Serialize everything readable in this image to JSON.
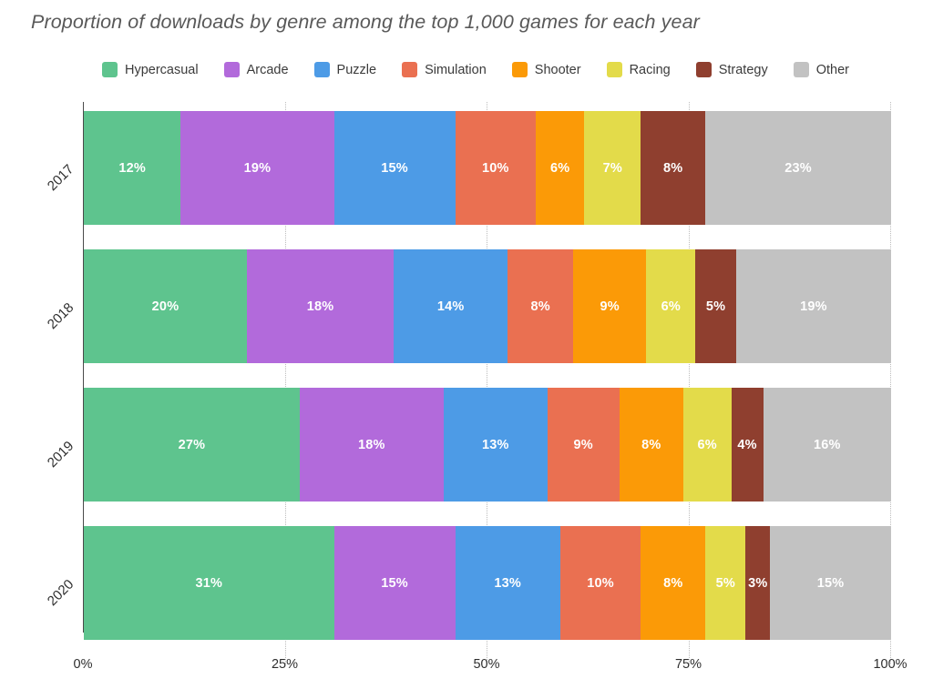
{
  "chart_data": {
    "type": "bar",
    "orientation": "horizontal",
    "stacked": true,
    "normalized": true,
    "title": "Proportion of downloads by genre among the top 1,000 games for each year",
    "xlabel": "",
    "ylabel": "",
    "categories": [
      "2017",
      "2018",
      "2019",
      "2020"
    ],
    "xlim": [
      0,
      100
    ],
    "xticks": [
      0,
      25,
      50,
      75,
      100
    ],
    "xtick_labels": [
      "0%",
      "25%",
      "50%",
      "75%",
      "100%"
    ],
    "grid": "vertical-dotted",
    "legend_position": "top",
    "series": [
      {
        "name": "Hypercasual",
        "color": "#5EC48E",
        "values": [
          12,
          20,
          27,
          31
        ],
        "labels": [
          "12%",
          "20%",
          "27%",
          "31%"
        ]
      },
      {
        "name": "Arcade",
        "color": "#B26ADB",
        "values": [
          19,
          18,
          18,
          15
        ],
        "labels": [
          "19%",
          "18%",
          "18%",
          "15%"
        ]
      },
      {
        "name": "Puzzle",
        "color": "#4D9BE6",
        "values": [
          15,
          14,
          13,
          13
        ],
        "labels": [
          "15%",
          "14%",
          "13%",
          "13%"
        ]
      },
      {
        "name": "Simulation",
        "color": "#EA7051",
        "values": [
          10,
          8,
          9,
          10
        ],
        "labels": [
          "10%",
          "8%",
          "9%",
          "10%"
        ]
      },
      {
        "name": "Shooter",
        "color": "#FB9A07",
        "values": [
          6,
          9,
          8,
          8
        ],
        "labels": [
          "6%",
          "9%",
          "8%",
          "8%"
        ]
      },
      {
        "name": "Racing",
        "color": "#E3DB4A",
        "values": [
          7,
          6,
          6,
          5
        ],
        "labels": [
          "7%",
          "6%",
          "6%",
          "5%"
        ]
      },
      {
        "name": "Strategy",
        "color": "#8F3F2F",
        "values": [
          8,
          5,
          4,
          3
        ],
        "labels": [
          "8%",
          "5%",
          "4%",
          "3%"
        ]
      },
      {
        "name": "Other",
        "color": "#C2C2C2",
        "values": [
          23,
          19,
          16,
          15
        ],
        "labels": [
          "23%",
          "19%",
          "16%",
          "15%"
        ]
      }
    ]
  },
  "legend": {
    "items": [
      {
        "label": "Hypercasual",
        "color": "#5EC48E"
      },
      {
        "label": "Arcade",
        "color": "#B26ADB"
      },
      {
        "label": "Puzzle",
        "color": "#4D9BE6"
      },
      {
        "label": "Simulation",
        "color": "#EA7051"
      },
      {
        "label": "Shooter",
        "color": "#FB9A07"
      },
      {
        "label": "Racing",
        "color": "#E3DB4A"
      },
      {
        "label": "Strategy",
        "color": "#8F3F2F"
      },
      {
        "label": "Other",
        "color": "#C2C2C2"
      }
    ]
  },
  "axes": {
    "x_tick_labels": [
      "0%",
      "25%",
      "50%",
      "75%",
      "100%"
    ],
    "y_tick_labels": [
      "2017",
      "2018",
      "2019",
      "2020"
    ]
  },
  "style": {
    "title_color": "#595959",
    "axis_color": "#4a4a4a",
    "grid_color": "#bdbdbd",
    "label_text_color": "#ffffff",
    "background": "#ffffff"
  }
}
